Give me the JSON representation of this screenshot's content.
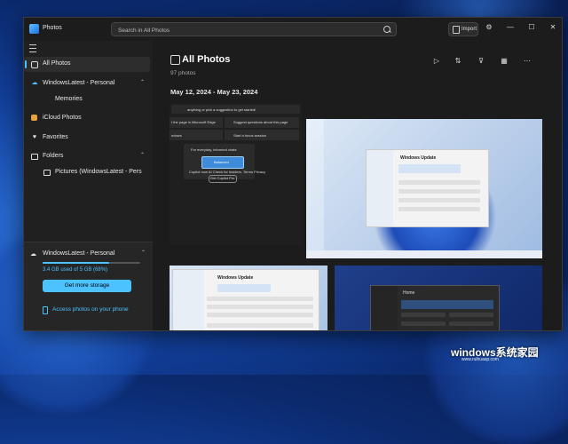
{
  "window": {
    "app_title": "Photos",
    "search_placeholder": "Search in All Photos",
    "import_label": "Import"
  },
  "sidebar": {
    "items": [
      {
        "label": "All Photos",
        "selected": true,
        "icon": "photos-icon"
      },
      {
        "label": "WindowsLatest - Personal",
        "icon": "onedrive-cloud-icon"
      },
      {
        "label": "Memories",
        "icon": "memories-icon"
      },
      {
        "label": "iCloud Photos",
        "icon": "icloud-icon"
      },
      {
        "label": "Favorites",
        "icon": "heart-icon"
      },
      {
        "label": "Folders",
        "icon": "folder-icon"
      },
      {
        "label": "Pictures (WindowsLatest - Pers",
        "icon": "folder-icon"
      }
    ],
    "storage": {
      "account": "WindowsLatest - Personal",
      "used_text": "3.4 GB used of 5 GB (68%)",
      "used_fraction": 0.68,
      "button_label": "Get more storage",
      "phone_link": "Access photos on your phone"
    }
  },
  "main": {
    "title": "All Photos",
    "count": "97 photos",
    "date_range": "May 12, 2024 - May 23, 2024"
  },
  "thumbnails": {
    "t1": {
      "line1": "anything or pick a suggestion to get started!",
      "line2": "t the page in Microsoft Edge",
      "line3": "Suggest questions about this page",
      "line4": "ndows",
      "line5": "Start a focus session",
      "line6": "For everyday, informed chats",
      "line7": "Balanced",
      "line8": "Copilot now AI Check for Insiders. Terms    Privacy",
      "line9": "Get Copilot Pro"
    },
    "t2": {
      "title": "Windows Update"
    },
    "t3": {
      "title": "Windows Update"
    },
    "t4": {
      "title": "Home"
    }
  },
  "watermark": {
    "line1": "windows系统家园",
    "line2": "www.ruihuasp.com"
  },
  "colors": {
    "accent": "#4cc2ff",
    "window_bg": "#202020"
  }
}
